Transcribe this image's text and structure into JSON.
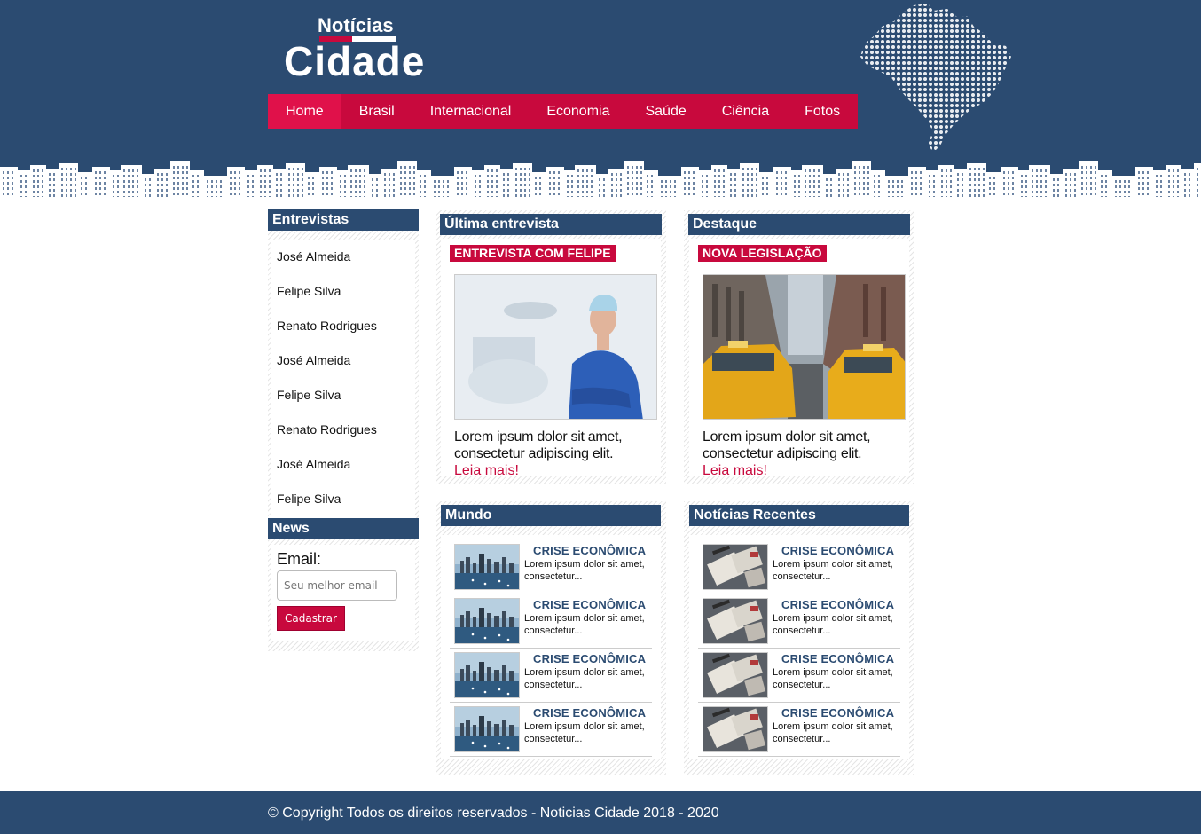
{
  "logo": {
    "top_text": "Notícias",
    "main_text": "Cidade"
  },
  "nav": {
    "items": [
      {
        "label": "Home",
        "active": true
      },
      {
        "label": "Brasil"
      },
      {
        "label": "Internacional"
      },
      {
        "label": "Economia"
      },
      {
        "label": "Saúde"
      },
      {
        "label": "Ciência"
      },
      {
        "label": "Fotos"
      }
    ]
  },
  "sidebar": {
    "interviews_title": "Entrevistas",
    "interviews": [
      "José Almeida",
      "Felipe Silva",
      "Renato Rodrigues",
      "José Almeida",
      "Felipe Silva",
      "Renato Rodrigues",
      "José Almeida",
      "Felipe Silva"
    ],
    "news_title": "News",
    "email_label": "Email:",
    "email_placeholder": "Seu melhor email",
    "subscribe_label": "Cadastrar"
  },
  "latest_interview": {
    "title": "Última entrevista",
    "tag": "ENTREVISTA COM FELIPE",
    "text": "Lorem ipsum dolor sit amet, consectetur adipiscing elit.",
    "link": "Leia mais!"
  },
  "highlight": {
    "title": "Destaque",
    "tag": "NOVA LEGISLAÇÃO",
    "text": "Lorem ipsum dolor sit amet, consectetur adipiscing elit.",
    "link": "Leia mais!"
  },
  "world": {
    "title": "Mundo",
    "items": [
      {
        "title": "CRISE ECONÔMICA",
        "desc": "Lorem ipsum dolor sit amet, consectetur..."
      },
      {
        "title": "CRISE ECONÔMICA",
        "desc": "Lorem ipsum dolor sit amet, consectetur..."
      },
      {
        "title": "CRISE ECONÔMICA",
        "desc": "Lorem ipsum dolor sit amet, consectetur..."
      },
      {
        "title": "CRISE ECONÔMICA",
        "desc": "Lorem ipsum dolor sit amet, consectetur..."
      }
    ]
  },
  "recent": {
    "title": "Notícias Recentes",
    "items": [
      {
        "title": "CRISE ECONÔMICA",
        "desc": "Lorem ipsum dolor sit amet, consectetur..."
      },
      {
        "title": "CRISE ECONÔMICA",
        "desc": "Lorem ipsum dolor sit amet, consectetur..."
      },
      {
        "title": "CRISE ECONÔMICA",
        "desc": "Lorem ipsum dolor sit amet, consectetur..."
      },
      {
        "title": "CRISE ECONÔMICA",
        "desc": "Lorem ipsum dolor sit amet, consectetur..."
      }
    ]
  },
  "footer": {
    "text": "© Copyright Todos os direitos reservados - Noticias Cidade 2018 - 2020"
  },
  "colors": {
    "primary": "#2b4b71",
    "accent": "#c8093d"
  }
}
